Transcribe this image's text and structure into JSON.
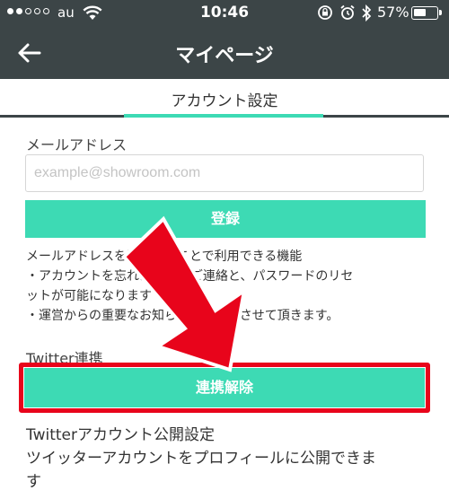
{
  "status_bar": {
    "carrier": "au",
    "time": "10:46",
    "battery": "57%",
    "battery_level": 0.57
  },
  "header": {
    "title": "マイページ"
  },
  "tab": {
    "label": "アカウント設定"
  },
  "email_section": {
    "label": "メールアドレス",
    "placeholder": "example@showroom.com",
    "value": "",
    "register_button": "登録"
  },
  "info": {
    "line1": "メールアドレスを登録することで利用できる機能",
    "line2": "・アカウントを忘れた際IDのご連絡と、パスワードのリセ",
    "line3": "ットが可能になります",
    "line4": "・運営からの重要なお知らせをご連絡させて頂きます。"
  },
  "twitter": {
    "label": "Twitter連携",
    "unlink_button": "連携解除",
    "public_setting_label": "Twitterアカウント公開設定",
    "public_setting_desc_1": "ツイッターアカウントをプロフィールに公開できま",
    "public_setting_desc_2": "す"
  },
  "colors": {
    "header_bg": "#3c4547",
    "accent": "#3ddab4",
    "annotation_red": "#e8041b"
  },
  "icons": [
    "back-arrow-icon",
    "wifi-icon",
    "rotation-lock-icon",
    "alarm-icon",
    "bluetooth-icon",
    "battery-icon",
    "annotation-arrow"
  ]
}
